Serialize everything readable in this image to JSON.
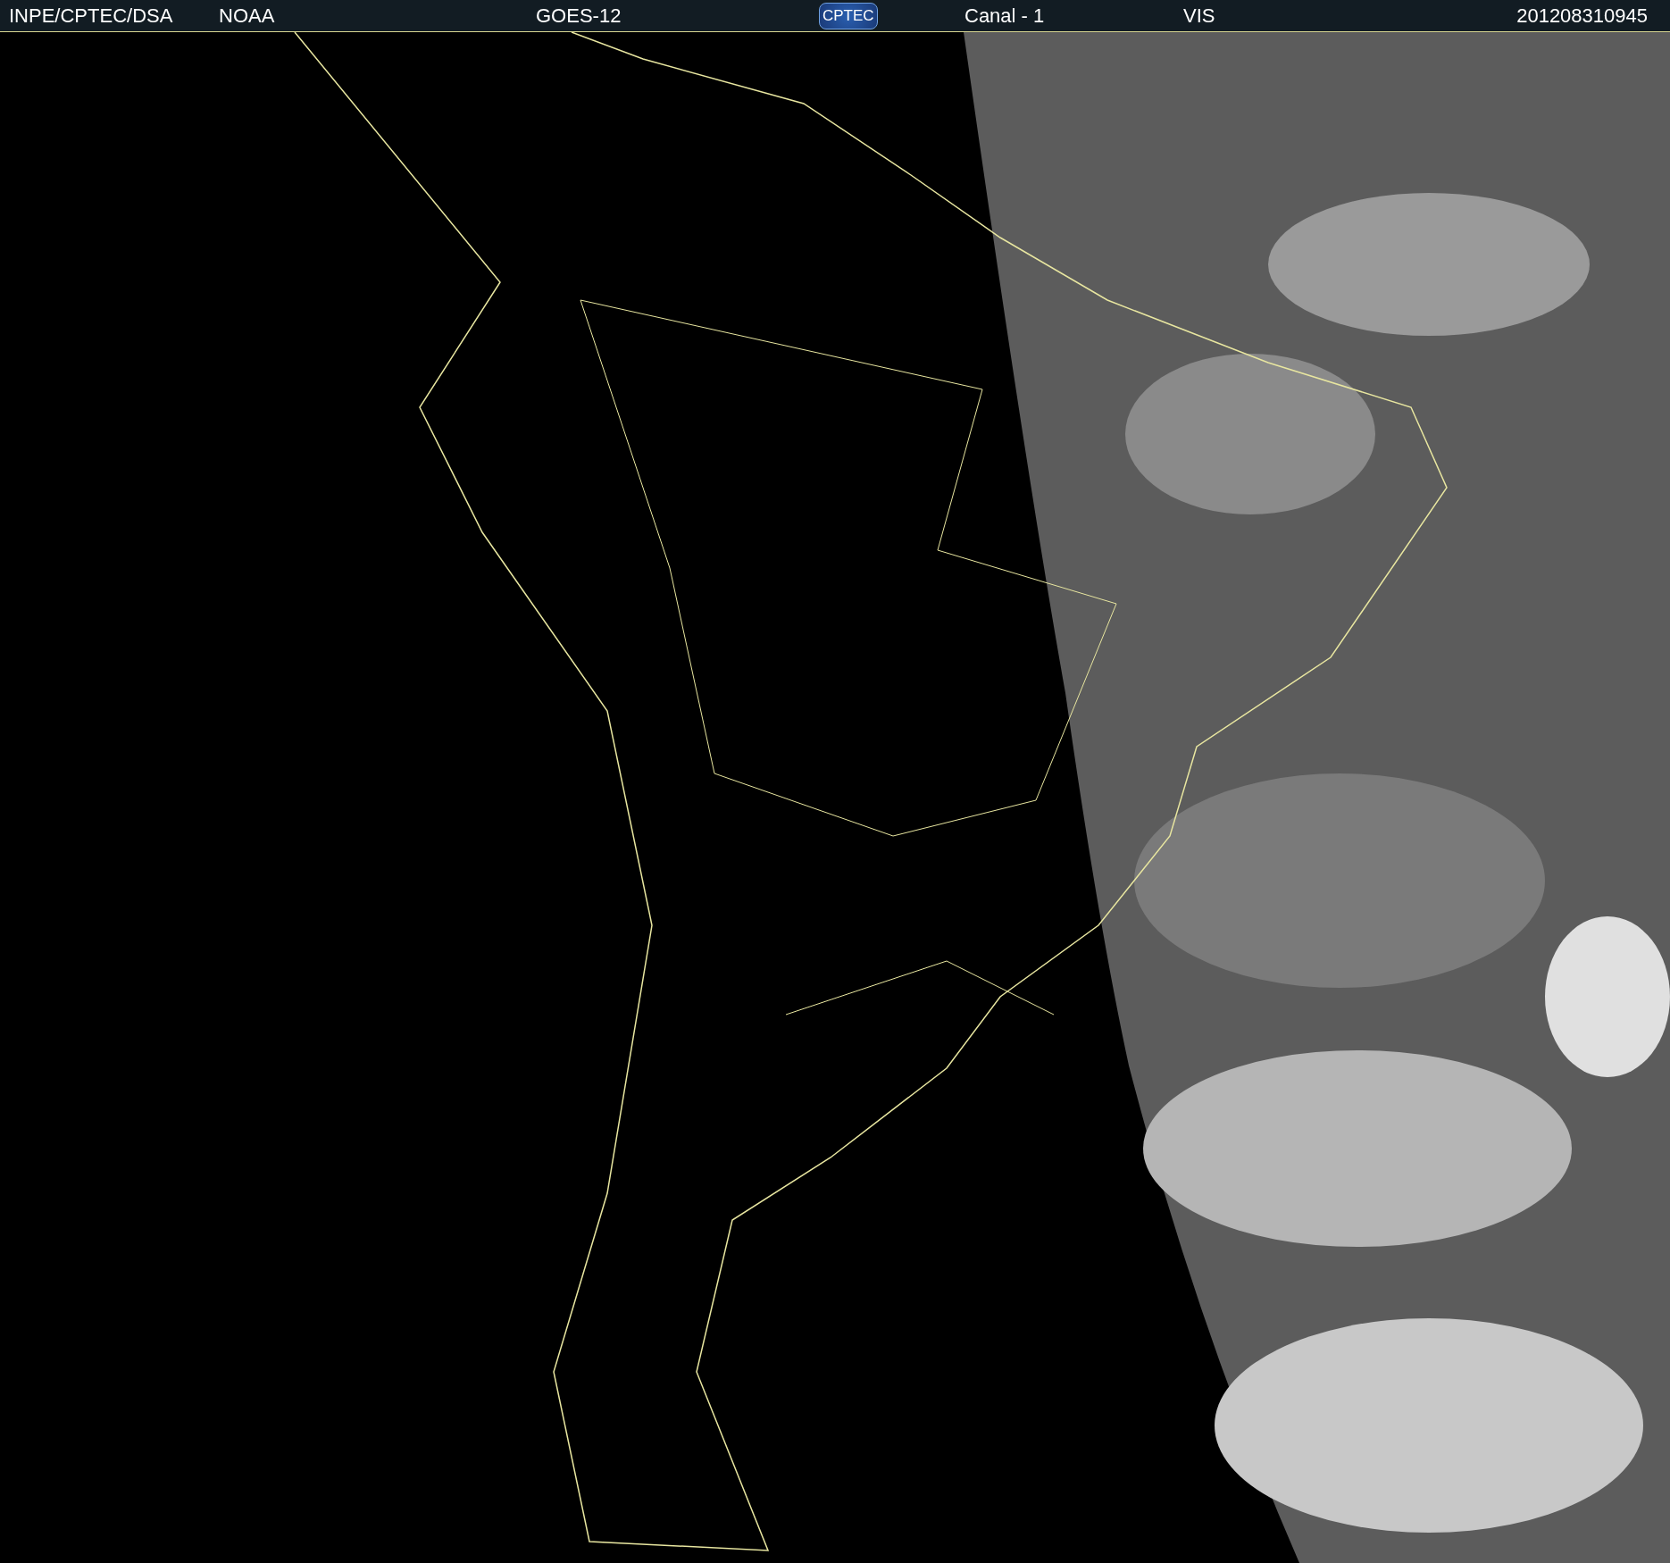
{
  "header": {
    "source": "INPE/CPTEC/DSA",
    "agency": "NOAA",
    "satellite": "GOES-12",
    "logo": "CPTEC",
    "channel": "Canal - 1",
    "band": "VIS",
    "timestamp": "201208310945"
  }
}
